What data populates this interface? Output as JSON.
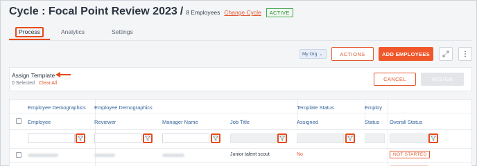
{
  "header": {
    "title": "Cycle : Focal Point Review 2023",
    "separator": "/",
    "employee_count": "8 Employees",
    "change_cycle": "Change Cycle",
    "status_badge": "ACTIVE"
  },
  "tabs": [
    {
      "label": "Process",
      "active": true
    },
    {
      "label": "Analytics",
      "active": false
    },
    {
      "label": "Settings",
      "active": false
    }
  ],
  "toolbar": {
    "org_select": "My Org",
    "actions_label": "ACTIONS",
    "add_employees_label": "ADD EMPLOYEES",
    "expand_icon": "expand-icon",
    "more_icon": "more-vertical-icon"
  },
  "assign_panel": {
    "title": "Assign Template",
    "selected": "0 Selected",
    "clear_all": "Clear All",
    "cancel_label": "CANCEL",
    "assign_label": "ASSIGN"
  },
  "table": {
    "group_headers": [
      "Employee Demographics",
      "Employee Demographics",
      "Template Status",
      "Employ"
    ],
    "columns": [
      "Employee",
      "Reviewer",
      "Manager Name",
      "Job Title",
      "Assigned",
      "Status",
      "Overall Status"
    ],
    "rows": [
      {
        "job_title": "Junior talent scout",
        "assigned": "No",
        "overall_status": "NOT STARTED"
      }
    ]
  },
  "colors": {
    "accent": "#e84a1a",
    "link_blue": "#2f5f9a",
    "active_green": "#2e8a3c"
  }
}
